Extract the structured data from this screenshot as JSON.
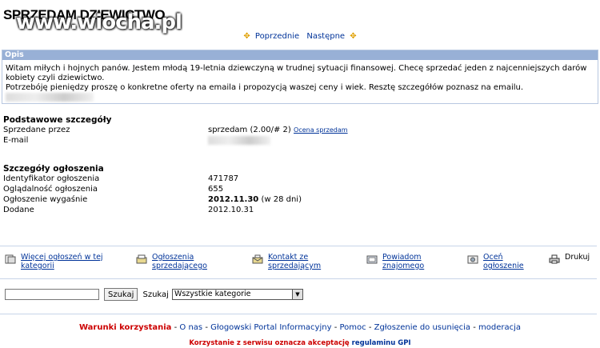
{
  "page": {
    "title": "SPRZEDAM DZIEWICTWO",
    "watermark": "www.wiocha.pl"
  },
  "pager": {
    "prev": "Poprzednie",
    "next": "Następne"
  },
  "opis": {
    "header": "Opis",
    "line1": "Witam miłych i hojnych panów. Jestem młodą 19-letnia dziewczyną w trudnej sytuacji finansowej. Checę sprzedać jeden z najcenniejszych darów",
    "line2": "kobiety czyli dziewictwo.",
    "line3": "Potrzebóję pieniędzy proszę o konkretne oferty na emaila i propozycją waszej ceny i wiek. Resztę szczegółów poznasz na emailu."
  },
  "basic": {
    "title": "Podstawowe szczegóły",
    "sold_by_label": "Sprzedane przez",
    "sold_by_value": "sprzedam (2.00/# 2)",
    "rate_link": "Ocena sprzedam",
    "email_label": "E-mail"
  },
  "details": {
    "title": "Szczegóły ogłoszenia",
    "id_label": "Identyfikator ogłoszenia",
    "id_value": "471787",
    "views_label": "Oglądalność ogłoszenia",
    "views_value": "655",
    "expires_label": "Ogłoszenie wygaśnie",
    "expires_value": "2012.11.30",
    "expires_note": "(w 28 dni)",
    "added_label": "Dodane",
    "added_value": "2012.10.31"
  },
  "actions": [
    {
      "line1": "Więcej ogłoszeń w tej",
      "line2": "kategorii",
      "icon": "more-ads-icon"
    },
    {
      "line1": "Ogłoszenia",
      "line2": "sprzedającego",
      "icon": "seller-ads-icon"
    },
    {
      "line1": "Kontakt ze",
      "line2": "sprzedającym",
      "icon": "contact-icon"
    },
    {
      "line1": "Powiadom",
      "line2": "znajomego",
      "icon": "notify-friend-icon"
    },
    {
      "line1": "Oceń",
      "line2": "ogłoszenie",
      "icon": "rate-icon"
    },
    {
      "line1": "Drukuj",
      "line2": "",
      "icon": "print-icon"
    }
  ],
  "search": {
    "button": "Szukaj",
    "label": "Szukaj",
    "category": "Wszystkie kategorie",
    "value": ""
  },
  "footer": {
    "terms": "Warunki korzystania",
    "about": "O nas",
    "portal": "Głogowski Portal Informacyjny",
    "help": "Pomoc",
    "report": "Zgłoszenie do usunięcia",
    "moderation": "moderacja",
    "sep": " - ",
    "notice": "Korzystanie z serwisu oznacza akceptację",
    "notice_link": "regulaminu GPI"
  }
}
